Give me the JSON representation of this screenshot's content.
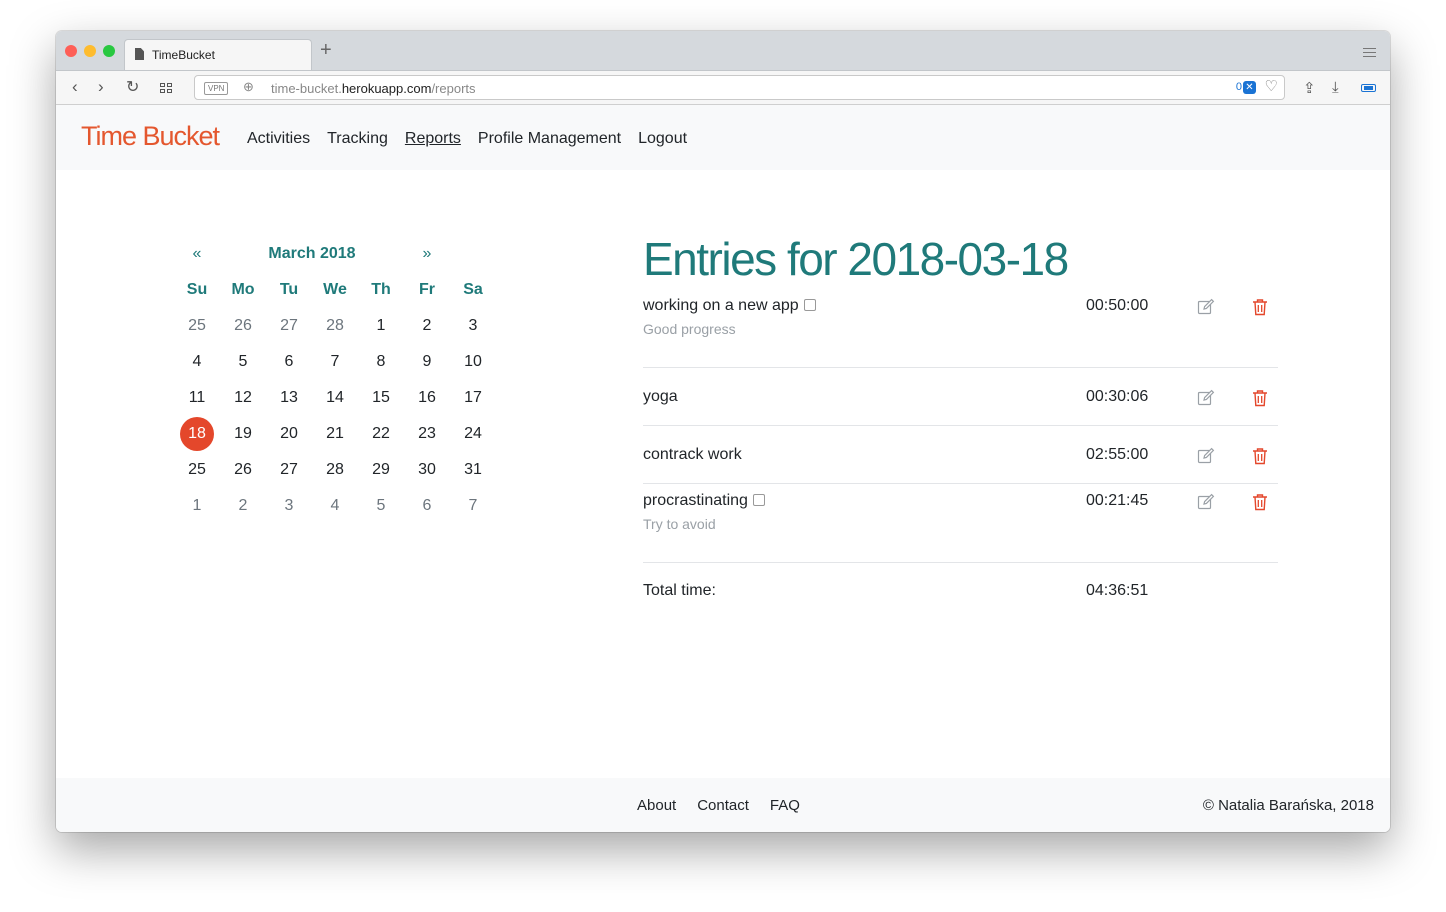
{
  "browser": {
    "tab_title": "TimeBucket",
    "url_prefix": "time-bucket.",
    "url_host": "herokuapp.com",
    "url_path": "/reports",
    "vpn_label": "VPN",
    "adblock_count": "0",
    "colors": {
      "close": "#fe5f57",
      "minimize": "#febc2e",
      "maximize": "#28c840"
    }
  },
  "nav": {
    "brand": "Time Bucket",
    "links": [
      "Activities",
      "Tracking",
      "Reports",
      "Profile Management",
      "Logout"
    ],
    "active": "Reports"
  },
  "calendar": {
    "prev": "«",
    "next": "»",
    "month": "March 2018",
    "weekdays": [
      "Su",
      "Mo",
      "Tu",
      "We",
      "Th",
      "Fr",
      "Sa"
    ],
    "weeks": [
      [
        "25",
        "26",
        "27",
        "28",
        "1",
        "2",
        "3"
      ],
      [
        "4",
        "5",
        "6",
        "7",
        "8",
        "9",
        "10"
      ],
      [
        "11",
        "12",
        "13",
        "14",
        "15",
        "16",
        "17"
      ],
      [
        "18",
        "19",
        "20",
        "21",
        "22",
        "23",
        "24"
      ],
      [
        "25",
        "26",
        "27",
        "28",
        "29",
        "30",
        "31"
      ],
      [
        "1",
        "2",
        "3",
        "4",
        "5",
        "6",
        "7"
      ]
    ],
    "selected": "18",
    "accent_color": "#1f7a7a",
    "selected_color": "#e4472b"
  },
  "entries": {
    "title": "Entries for 2018-03-18",
    "items": [
      {
        "name": "working on a new app",
        "note": "Good progress",
        "time": "00:50:00"
      },
      {
        "name": "yoga",
        "note": "",
        "time": "00:30:06"
      },
      {
        "name": "contrack work",
        "note": "",
        "time": "02:55:00"
      },
      {
        "name": "procrastinating",
        "note": "Try to avoid",
        "time": "00:21:45"
      }
    ],
    "total_label": "Total time:",
    "total_time": "04:36:51"
  },
  "footer": {
    "links": [
      "About",
      "Contact",
      "FAQ"
    ],
    "copyright": "© Natalia Barańska, 2018"
  }
}
